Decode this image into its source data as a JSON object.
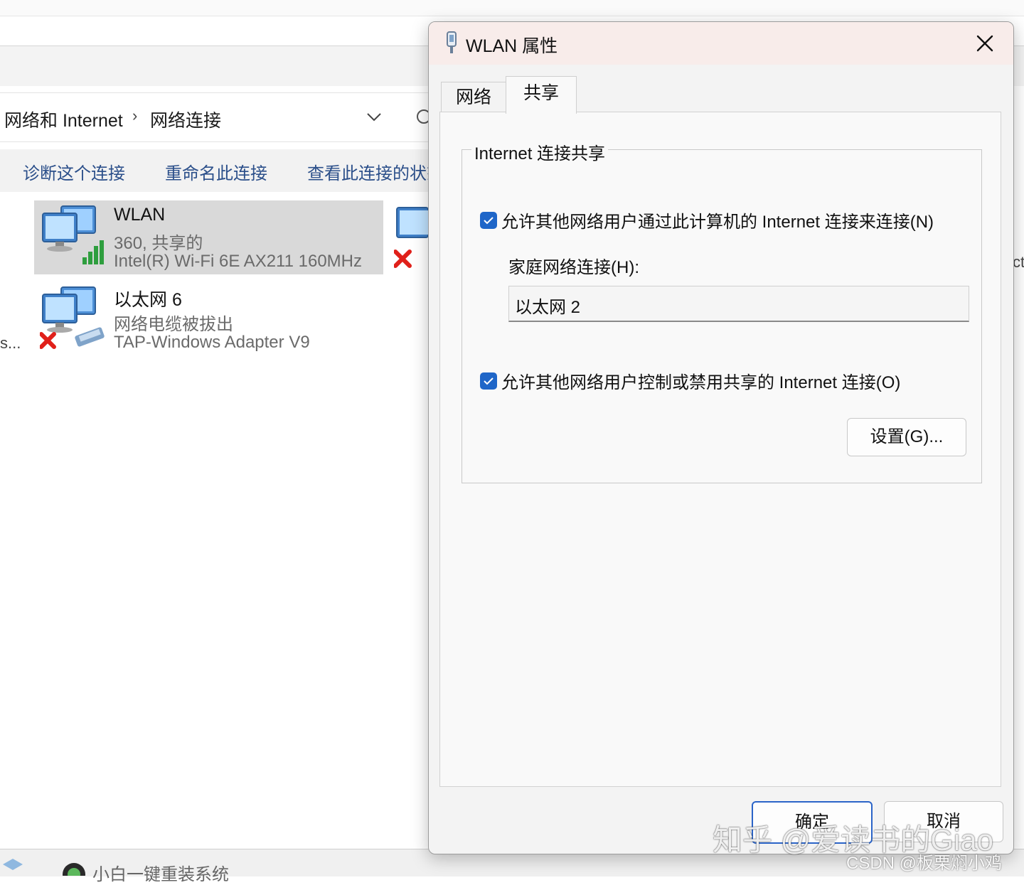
{
  "explorer": {
    "breadcrumb": [
      "网络和 Internet",
      "网络连接"
    ],
    "breadcrumb_separator": "›",
    "commands": [
      "诊断这个连接",
      "重命名此连接",
      "查看此连接的状态"
    ],
    "connections": [
      {
        "name": "WLAN",
        "status": "360, 共享的",
        "adapter": "Intel(R) Wi-Fi 6E AX211 160MHz",
        "icon": "wireless-network-icon",
        "selected": true
      },
      {
        "name": "以太网 6",
        "status": "网络电缆被拔出",
        "adapter": "TAP-Windows Adapter V9",
        "icon": "ethernet-disconnected-icon",
        "selected": false
      }
    ],
    "partial_right_text": "ct",
    "partial_left_text": "s...",
    "taskbar_text": "小白一键重装系统"
  },
  "dialog": {
    "title": "WLAN 属性",
    "close_icon": "close-icon",
    "tabs": [
      {
        "label": "网络",
        "active": false
      },
      {
        "label": "共享",
        "active": true
      }
    ],
    "group_title": "Internet 连接共享",
    "allow_connect": {
      "label": "允许其他网络用户通过此计算机的 Internet 连接来连接(N)",
      "checked": true
    },
    "home_network_label": "家庭网络连接(H):",
    "home_network_value": "以太网 2",
    "allow_control": {
      "label": "允许其他网络用户控制或禁用共享的 Internet 连接(O)",
      "checked": true
    },
    "settings_button": "设置(G)...",
    "ok_button": "确定",
    "cancel_button": "取消"
  },
  "watermark": {
    "zhihu": "知乎 @爱读书的Giao",
    "csdn": "CSDN @板栗焖小鸡"
  },
  "colors": {
    "accent": "#1f66c8",
    "selection": "#d9d9d9",
    "command_text": "#2b4f8a",
    "dialog_titlebar": "#f8ecea"
  }
}
